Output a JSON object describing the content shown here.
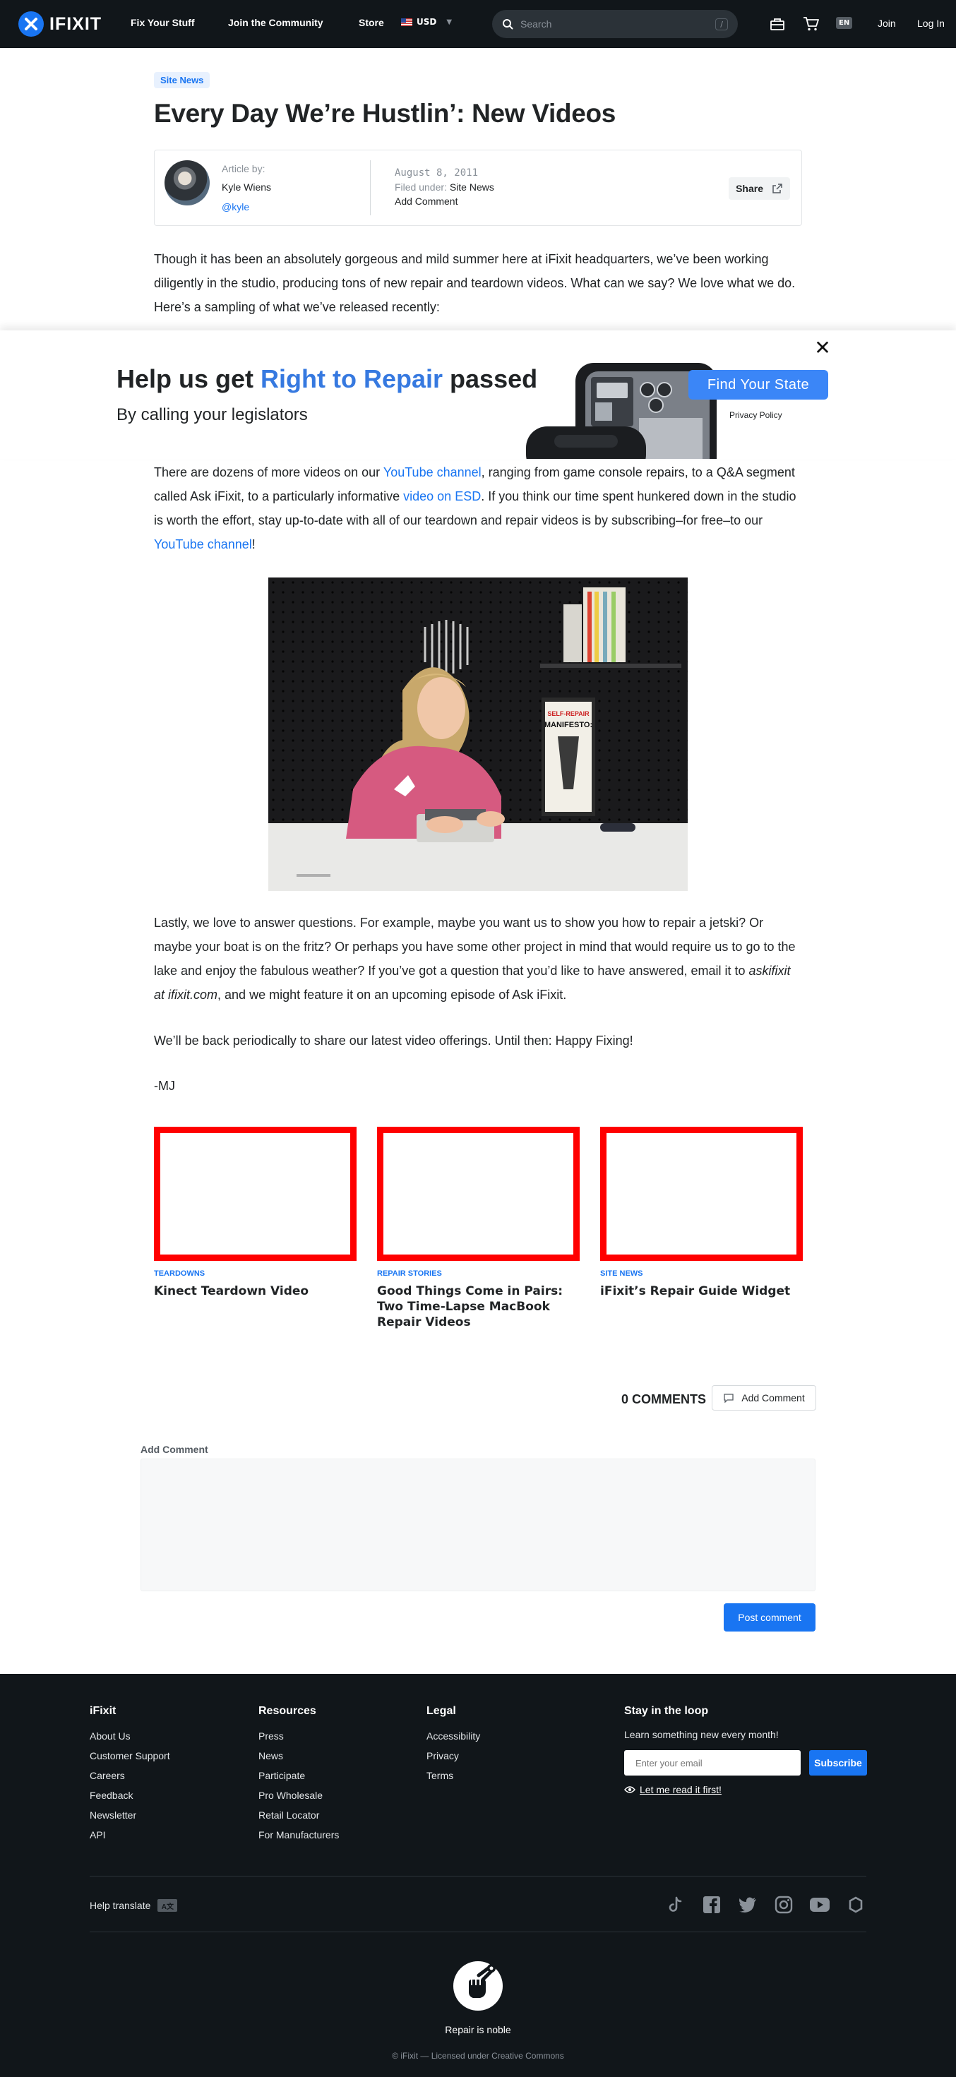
{
  "nav": {
    "logo_text": "IFIXIT",
    "links": [
      "Fix Your Stuff",
      "Join the Community",
      "Store"
    ],
    "currency": "USD",
    "search_placeholder": "Search",
    "search_shortcut": "/",
    "lang": "EN",
    "join": "Join",
    "login": "Log In"
  },
  "article": {
    "category": "Site News",
    "title": "Every Day We’re Hustlin’: New Videos",
    "by_label": "Article by:",
    "author": "Kyle Wiens",
    "handle": "@kyle",
    "date": "August 8, 2011",
    "filed_label": "Filed under:",
    "filed_value": "Site News",
    "add_comment": "Add Comment",
    "share": "Share",
    "intro": "Though it has been an absolutely gorgeous and mild summer here at iFixit headquarters, we’ve been working diligently in the studio, producing tons of new repair and teardown videos. What can we say? We love what we do. Here’s a sampling of what we’ve released recently:",
    "p2_a": "There are dozens of more videos on our ",
    "p2_link1": "YouTube channel",
    "p2_b": ", ranging from game console repairs, to a Q&A segment called Ask iFixit, to a particularly informative ",
    "p2_link2": "video on ESD",
    "p2_c": ". If you think our time spent hunkered down in the studio is worth the effort, stay up-to-date with all of our teardown and repair videos is by subscribing–for free–to our ",
    "p2_link3": "YouTube channel",
    "p2_d": "!",
    "p3_a": "Lastly, we love to answer questions. For example, maybe you want us to show you how to repair a jetski? Or maybe your boat is on the fritz? Or perhaps you have some other project in mind that would require us to go to the lake and enjoy the fabulous weather? If you’ve got a question that you’d like to have answered, email it to ",
    "p3_em": "askifixit at ifixit.com",
    "p3_b": ", and we might feature it on an upcoming episode of Ask iFixit.",
    "p4": "We’ll be back periodically to share our latest video offerings. Until then: Happy Fixing!",
    "sign": "-MJ",
    "poster_line1": "SELF-REPAIR",
    "poster_line2": "MANIFESTO:"
  },
  "banner": {
    "title_a": "Help us get ",
    "title_hl": "Right to Repair",
    "title_b": " passed",
    "subtitle": "By calling your legislators",
    "cta": "Find Your State",
    "privacy": "Privacy Policy",
    "close": "✕"
  },
  "related": [
    {
      "tag": "TEARDOWNS",
      "title": "Kinect Teardown Video"
    },
    {
      "tag": "REPAIR STORIES",
      "title": "Good Things Come in Pairs: Two Time-Lapse MacBook Repair Videos"
    },
    {
      "tag": "SITE NEWS",
      "title": "iFixit’s Repair Guide Widget"
    }
  ],
  "comments": {
    "count": "0 COMMENTS",
    "add_btn": "Add Comment",
    "label": "Add Comment",
    "post": "Post comment"
  },
  "footer": {
    "col1": {
      "title": "iFixit",
      "links": [
        "About Us",
        "Customer Support",
        "Careers",
        "Feedback",
        "Newsletter",
        "API"
      ]
    },
    "col2": {
      "title": "Resources",
      "links": [
        "Press",
        "News",
        "Participate",
        "Pro Wholesale",
        "Retail Locator",
        "For Manufacturers"
      ]
    },
    "col3": {
      "title": "Legal",
      "links": [
        "Accessibility",
        "Privacy",
        "Terms"
      ]
    },
    "loop": {
      "title": "Stay in the loop",
      "desc": "Learn something new every month!",
      "placeholder": "Enter your email",
      "subscribe": "Subscribe",
      "read_first": "Let me read it first!"
    },
    "translate": "Help translate",
    "tagline": "Repair is noble",
    "copyright": "© iFixit — Licensed under Creative Commons"
  },
  "colors": {
    "brand_blue": "#1975f2",
    "nav_bg": "#11161a",
    "related_border": "#ff0000"
  }
}
